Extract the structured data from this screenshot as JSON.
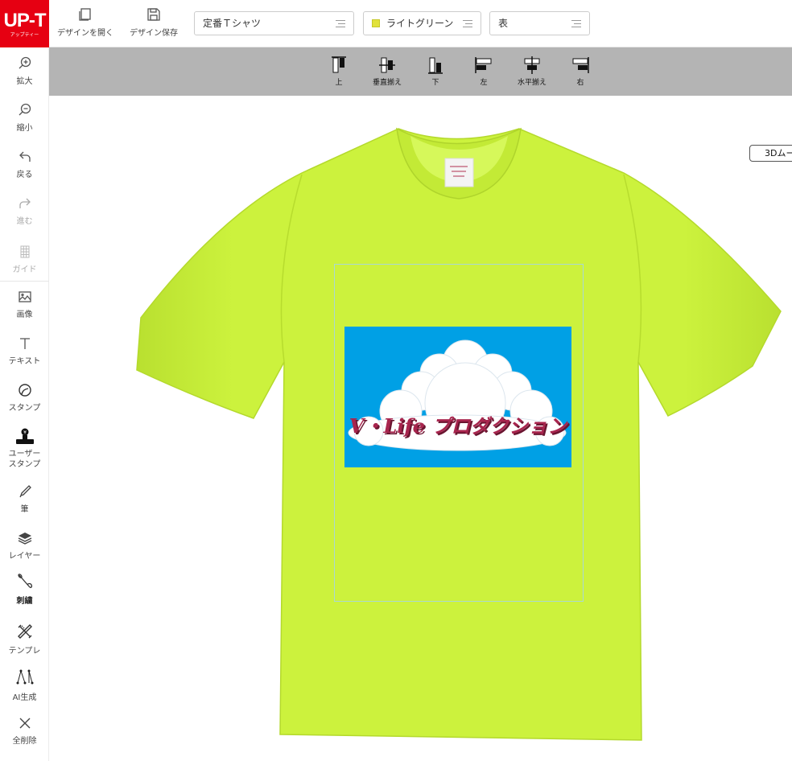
{
  "logo": {
    "main": "UP-T",
    "sub": "アップティー"
  },
  "toolbar": {
    "open_label": "デザインを開く",
    "save_label": "デザイン保存",
    "product": "定番Ｔシャツ",
    "color": "ライトグリーン",
    "color_hex": "#e1e23b",
    "side": "表"
  },
  "sidebar": {
    "zoom_in": "拡大",
    "zoom_out": "縮小",
    "undo": "戻る",
    "redo": "進む",
    "guide": "ガイド",
    "image": "画像",
    "text": "テキスト",
    "stamp": "スタンプ",
    "user_stamp_1": "ユーザー",
    "user_stamp_2": "スタンプ",
    "brush": "筆",
    "layer": "レイヤー",
    "embroidery": "刺繍",
    "template": "テンプレ",
    "ai": "AI生成",
    "clear_all": "全削除"
  },
  "align": {
    "top": "上",
    "v_center": "垂直揃え",
    "bottom": "下",
    "left": "左",
    "h_center": "水平揃え",
    "right": "右"
  },
  "canvas": {
    "mode_3d": "3Dムー",
    "design_text": "V・Life プロダクション",
    "shirt_color": "#ccf23d",
    "sky_color": "#00a0e5",
    "text_color": "#a8254e"
  }
}
